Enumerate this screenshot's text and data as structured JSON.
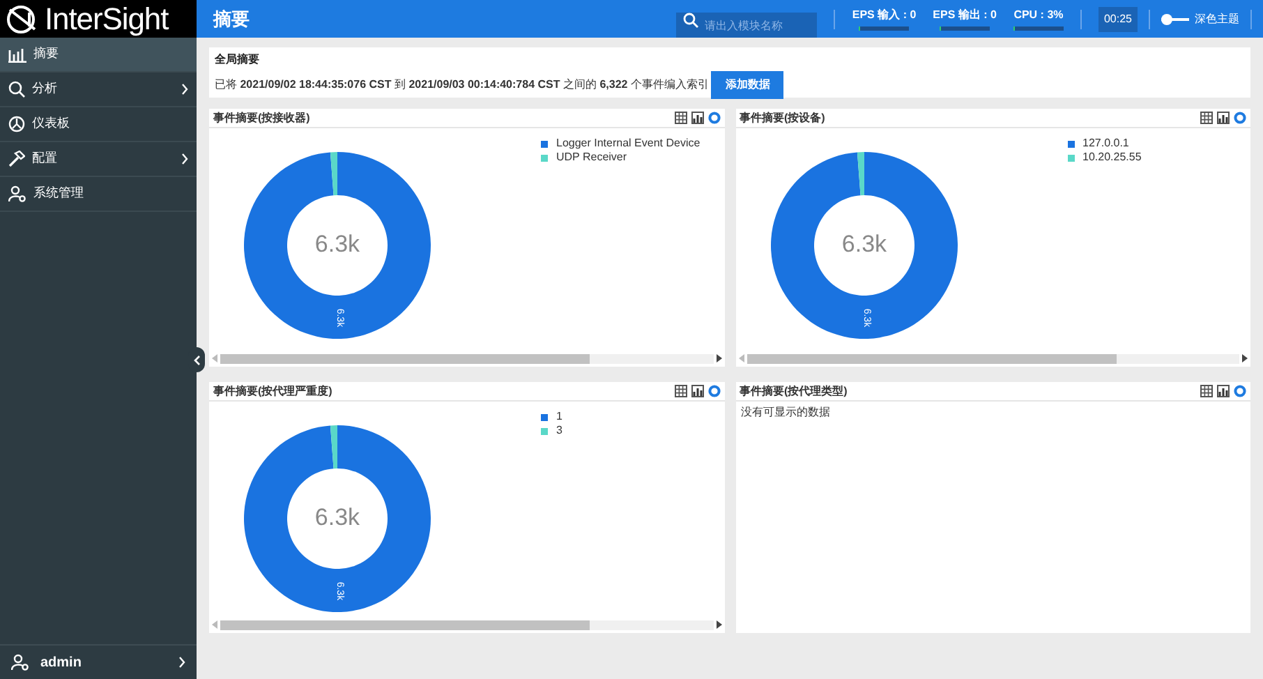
{
  "logo": {
    "text": "InterSight"
  },
  "sidebar": {
    "items": [
      {
        "label": "摘要",
        "has_submenu": false,
        "selected": true
      },
      {
        "label": "分析",
        "has_submenu": true,
        "selected": false
      },
      {
        "label": "仪表板",
        "has_submenu": false,
        "selected": false
      },
      {
        "label": "配置",
        "has_submenu": true,
        "selected": false
      },
      {
        "label": "系统管理",
        "has_submenu": false,
        "selected": false
      }
    ],
    "user": {
      "label": "admin"
    }
  },
  "header": {
    "title": "摘要",
    "search": {
      "placeholder": "请出入模块名称"
    },
    "stats": [
      {
        "label": "EPS 输入 : 0",
        "level": 0
      },
      {
        "label": "EPS 输出 : 0",
        "level": 0
      },
      {
        "label": "CPU : 3%",
        "level": 0.03
      }
    ],
    "clock": "00:25",
    "theme_toggle": {
      "label": "深色主题",
      "on": false
    }
  },
  "global_summary": {
    "title": "全局摘要",
    "parts": [
      "已将",
      "2021/09/02 18:44:35:076 CST",
      "到",
      "2021/09/03 00:14:40:784 CST",
      "之间的",
      "6,322",
      "个事件编入索引"
    ],
    "button": "添加数据"
  },
  "panels": [
    {
      "title": "事件摘要(按接收器)",
      "center": "6.3k",
      "slices": [
        {
          "name": "Logger Internal Event Device",
          "color": "#1a73e0",
          "label": "6.3k"
        },
        {
          "name": "UDP Receiver",
          "color": "#5ad8c8"
        }
      ]
    },
    {
      "title": "事件摘要(按设备)",
      "center": "6.3k",
      "slices": [
        {
          "name": "127.0.0.1",
          "color": "#1a73e0",
          "label": "6.3k"
        },
        {
          "name": "10.20.25.55",
          "color": "#5ad8c8"
        }
      ]
    },
    {
      "title": "事件摘要(按代理严重度)",
      "center": "6.3k",
      "slices": [
        {
          "name": "1",
          "color": "#1a73e0",
          "label": "6.3k"
        },
        {
          "name": "3",
          "color": "#5ad8c8"
        }
      ]
    },
    {
      "title": "事件摘要(按代理类型)",
      "empty_text": "没有可显示的数据"
    }
  ]
}
